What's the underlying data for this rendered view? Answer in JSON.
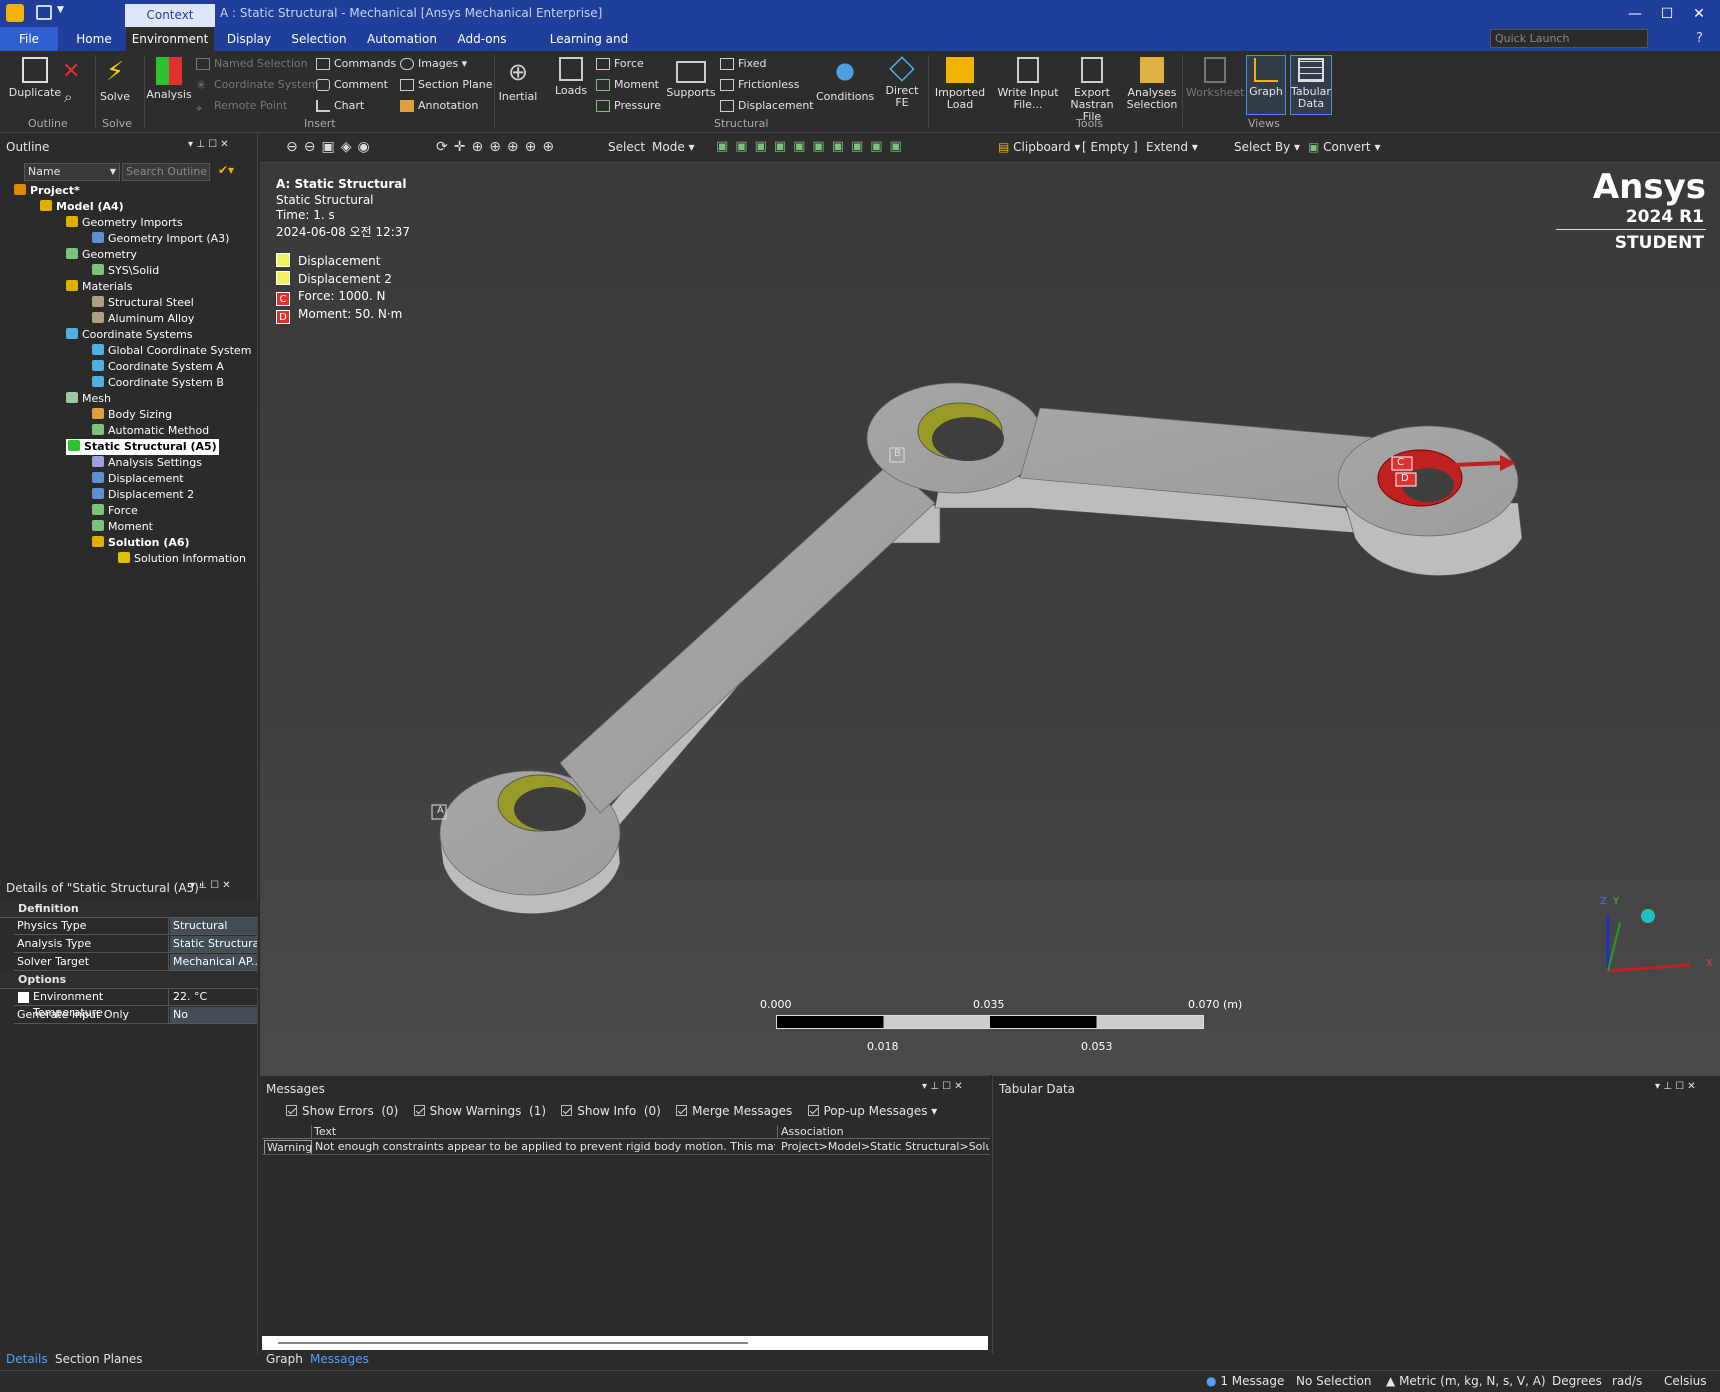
{
  "titlebar": {
    "context_tab": "Context",
    "title": "A : Static Structural - Mechanical [Ansys Mechanical Enterprise]"
  },
  "menu": {
    "tabs": [
      "File",
      "Home",
      "Environment",
      "Display",
      "Selection",
      "Automation",
      "Add-ons",
      "Learning and Support"
    ],
    "active": "Environment",
    "quick_launch_placeholder": "Quick Launch"
  },
  "ribbon": {
    "outline": {
      "duplicate": "Duplicate",
      "group": "Outline"
    },
    "solve": {
      "solve": "Solve",
      "group": "Solve"
    },
    "insert": {
      "analysis": "Analysis",
      "named_selection": "Named Selection",
      "coordinate_system": "Coordinate System",
      "remote_point": "Remote Point",
      "commands": "Commands",
      "comment": "Comment",
      "chart": "Chart",
      "images": "Images",
      "section_plane": "Section Plane",
      "annotation": "Annotation",
      "group": "Insert"
    },
    "structural": {
      "inertial": "Inertial",
      "loads": "Loads",
      "force": "Force",
      "moment": "Moment",
      "pressure": "Pressure",
      "supports": "Supports",
      "fixed": "Fixed",
      "frictionless": "Frictionless",
      "displacement": "Displacement",
      "conditions": "Conditions",
      "direct_fe": "Direct FE",
      "group": "Structural"
    },
    "tools": {
      "imported_load": "Imported Load",
      "write_input": "Write Input File...",
      "export_nastran": "Export Nastran File",
      "analyses_selection": "Analyses Selection",
      "group": "Tools"
    },
    "views": {
      "worksheet": "Worksheet",
      "graph": "Graph",
      "tabular": "Tabular Data",
      "group": "Views"
    }
  },
  "outline": {
    "title": "Outline",
    "filter_name": "Name",
    "search_placeholder": "Search Outline",
    "tree": [
      {
        "label": "Project*",
        "depth": 0,
        "bold": true,
        "icon": "#e08a00"
      },
      {
        "label": "Model (A4)",
        "depth": 1,
        "bold": true,
        "icon": "#e0b000"
      },
      {
        "label": "Geometry Imports",
        "depth": 2,
        "icon": "#e0b000"
      },
      {
        "label": "Geometry Import (A3)",
        "depth": 3,
        "icon": "#5a8fd0"
      },
      {
        "label": "Geometry",
        "depth": 2,
        "icon": "#7bc27b"
      },
      {
        "label": "SYS\\Solid",
        "depth": 3,
        "icon": "#7bc27b"
      },
      {
        "label": "Materials",
        "depth": 2,
        "icon": "#e0b000"
      },
      {
        "label": "Structural Steel",
        "depth": 3,
        "icon": "#b0a080"
      },
      {
        "label": "Aluminum Alloy",
        "depth": 3,
        "icon": "#b0a080"
      },
      {
        "label": "Coordinate Systems",
        "depth": 2,
        "icon": "#4fb0e0"
      },
      {
        "label": "Global Coordinate System",
        "depth": 3,
        "icon": "#4fb0e0"
      },
      {
        "label": "Coordinate System A",
        "depth": 3,
        "icon": "#4fb0e0"
      },
      {
        "label": "Coordinate System B",
        "depth": 3,
        "icon": "#4fb0e0"
      },
      {
        "label": "Mesh",
        "depth": 2,
        "icon": "#a0c8a0"
      },
      {
        "label": "Body Sizing",
        "depth": 3,
        "icon": "#e0a040"
      },
      {
        "label": "Automatic Method",
        "depth": 3,
        "icon": "#7bc27b"
      },
      {
        "label": "Static Structural (A5)",
        "depth": 2,
        "bold": true,
        "selected": true,
        "icon": "#30c030"
      },
      {
        "label": "Analysis Settings",
        "depth": 3,
        "icon": "#a0a0e0"
      },
      {
        "label": "Displacement",
        "depth": 3,
        "icon": "#5a8fd0"
      },
      {
        "label": "Displacement 2",
        "depth": 3,
        "icon": "#5a8fd0"
      },
      {
        "label": "Force",
        "depth": 3,
        "icon": "#7bc27b"
      },
      {
        "label": "Moment",
        "depth": 3,
        "icon": "#7bc27b"
      },
      {
        "label": "Solution (A6)",
        "depth": 3,
        "bold": true,
        "icon": "#e0b000"
      },
      {
        "label": "Solution Information",
        "depth": 4,
        "icon": "#e0c000"
      }
    ]
  },
  "details": {
    "title": "Details of \"Static Structural (A5)\"",
    "sections": [
      {
        "name": "Definition",
        "rows": [
          {
            "key": "Physics Type",
            "value": "Structural"
          },
          {
            "key": "Analysis Type",
            "value": "Static Structural"
          },
          {
            "key": "Solver Target",
            "value": "Mechanical AP..."
          }
        ]
      },
      {
        "name": "Options",
        "rows": [
          {
            "key": "Environment Temperature",
            "value": "22. °C"
          },
          {
            "key": "Generate Input Only",
            "value": "No"
          }
        ]
      }
    ]
  },
  "view_toolbar": {
    "select": "Select",
    "mode": "Mode",
    "clipboard": "Clipboard",
    "empty": "[ Empty ]",
    "extend": "Extend",
    "select_by": "Select By",
    "convert": "Convert"
  },
  "viewport": {
    "header_title": "A: Static Structural",
    "header_type": "Static Structural",
    "header_time": "Time: 1. s",
    "header_date": "2024-06-08 오전 12:37",
    "legend": [
      {
        "tag": "",
        "label": "Displacement",
        "color": "#f0f060"
      },
      {
        "tag": "",
        "label": "Displacement 2",
        "color": "#f0f060"
      },
      {
        "tag": "C",
        "label": "Force: 1000. N",
        "color": "#e03030"
      },
      {
        "tag": "D",
        "label": "Moment: 50. N·m",
        "color": "#e03030"
      }
    ],
    "brand": "Ansys",
    "version": "2024 R1",
    "edition": "STUDENT",
    "labels": {
      "a": "A",
      "b": "B",
      "c": "C",
      "d": "D"
    },
    "scale": {
      "t0": "0.000",
      "t1": "0.035",
      "t2": "0.070 (m)",
      "b1": "0.018",
      "b2": "0.053"
    },
    "triad": {
      "x": "X",
      "y": "Y",
      "z": "Z"
    }
  },
  "messages": {
    "title": "Messages",
    "show_errors": "Show Errors",
    "errors_count": "(0)",
    "show_warnings": "Show Warnings",
    "warnings_count": "(1)",
    "show_info": "Show Info",
    "info_count": "(0)",
    "merge": "Merge Messages",
    "popup": "Pop-up Messages",
    "col_text": "Text",
    "col_assoc": "Association",
    "row_type": "Warning",
    "row_text": "Not enough constraints appear to be applied to prevent rigid body motion.  This may le",
    "row_assoc": "Project>Model>Static Structural>Solutio"
  },
  "tabular": {
    "title": "Tabular Data"
  },
  "bottom_tabs": {
    "details": "Details",
    "section_planes": "Section Planes",
    "graph": "Graph",
    "messages": "Messages"
  },
  "status": {
    "messages": "1 Message",
    "selection": "No Selection",
    "units": "Metric (m, kg, N, s, V, A)",
    "angle": "Degrees",
    "rate": "rad/s",
    "temp": "Celsius"
  }
}
